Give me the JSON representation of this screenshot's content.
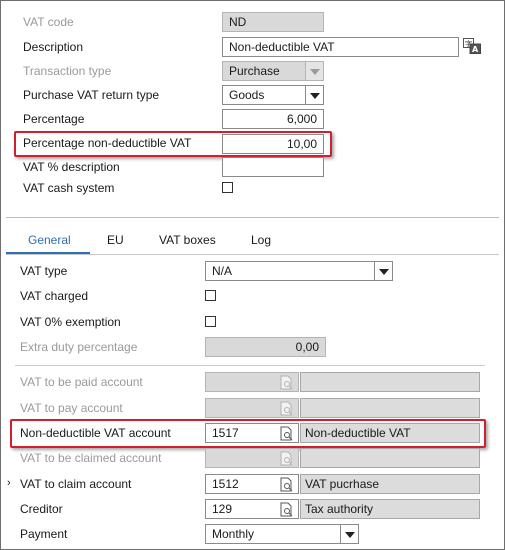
{
  "header": {
    "vat_code_label": "VAT code",
    "vat_code_value": "ND",
    "description_label": "Description",
    "description_value": "Non-deductible VAT",
    "transaction_type_label": "Transaction type",
    "transaction_type_value": "Purchase",
    "purchase_return_type_label": "Purchase VAT return type",
    "purchase_return_type_value": "Goods",
    "percentage_label": "Percentage",
    "percentage_value": "6,000",
    "pct_nondeductible_label": "Percentage non-deductible VAT",
    "pct_nondeductible_value": "10,00",
    "vat_pct_description_label": "VAT % description",
    "vat_pct_description_value": "",
    "vat_cash_system_label": "VAT cash system",
    "vat_cash_system_checked": false
  },
  "tabs": [
    {
      "label": "General",
      "active": true
    },
    {
      "label": "EU",
      "active": false
    },
    {
      "label": "VAT boxes",
      "active": false
    },
    {
      "label": "Log",
      "active": false
    }
  ],
  "general": {
    "vat_type_label": "VAT type",
    "vat_type_value": "N/A",
    "vat_charged_label": "VAT charged",
    "vat_charged_checked": false,
    "vat_0_exemption_label": "VAT 0% exemption",
    "vat_0_exemption_checked": false,
    "extra_duty_label": "Extra duty percentage",
    "extra_duty_value": "0,00",
    "vat_to_be_paid_label": "VAT to be paid account",
    "vat_to_pay_label": "VAT to pay account",
    "nondeductible_account_label": "Non-deductible VAT account",
    "nondeductible_account_value": "1517",
    "nondeductible_account_desc": "Non-deductible VAT",
    "vat_to_be_claimed_label": "VAT to be claimed account",
    "vat_to_claim_label": "VAT to claim account",
    "vat_to_claim_value": "1512",
    "vat_to_claim_desc": "VAT pucrhase",
    "creditor_label": "Creditor",
    "creditor_value": "129",
    "creditor_desc": "Tax authority",
    "payment_label": "Payment",
    "payment_value": "Monthly",
    "row_indicator": "›"
  },
  "colors": {
    "highlight": "#d11f2b",
    "tab_active": "#2f6fb3",
    "disabled_text": "#9a9a9a"
  },
  "icons": [
    "translate-icon",
    "dropdown-arrow-icon",
    "lookup-search-icon",
    "row-pointer-icon"
  ]
}
